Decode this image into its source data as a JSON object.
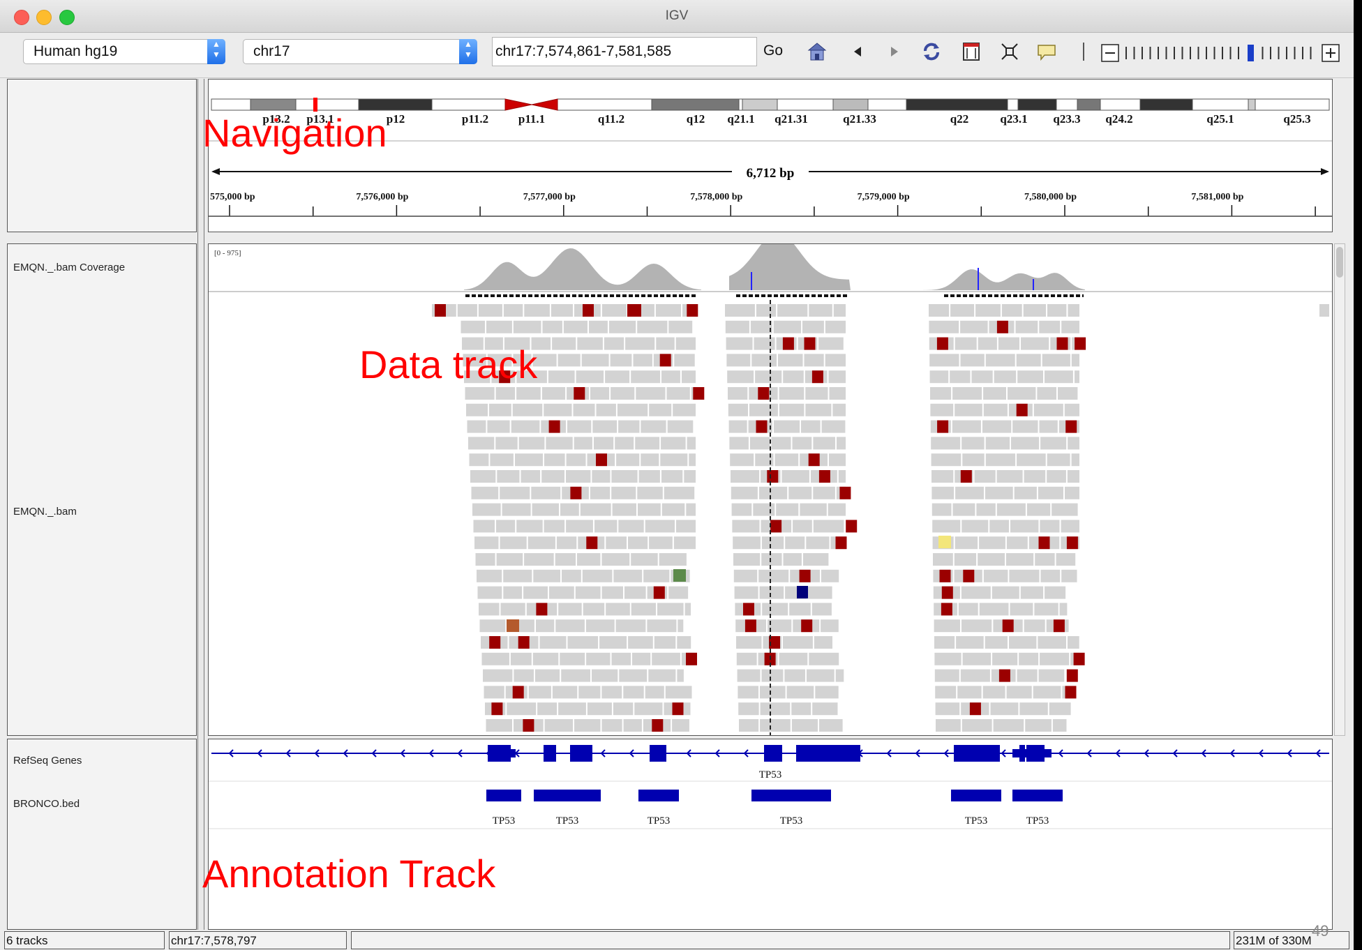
{
  "window": {
    "title": "IGV"
  },
  "toolbar": {
    "genome": "Human hg19",
    "chromosome": "chr17",
    "locus": "chr17:7,574,861-7,581,585",
    "go_label": "Go"
  },
  "ideogram": {
    "bands": [
      "p13.2",
      "p13.1",
      "p12",
      "p11.2",
      "p11.1",
      "q11.2",
      "q12",
      "q21.1",
      "q21.31",
      "q21.33",
      "q22",
      "q23.1",
      "q23.3",
      "q24.2",
      "q25.1",
      "q25.3"
    ]
  },
  "ruler": {
    "span": "6,712 bp",
    "ticks": [
      "575,000 bp",
      "7,576,000 bp",
      "7,577,000 bp",
      "7,578,000 bp",
      "7,579,000 bp",
      "7,580,000 bp",
      "7,581,000 bp"
    ]
  },
  "tracks": {
    "coverage_name": "EMQN._.bam Coverage",
    "coverage_range": "[0 - 975]",
    "bam_name": "EMQN._.bam",
    "refseq_name": "RefSeq Genes",
    "refseq_gene": "TP53",
    "bed_name": "BRONCO.bed",
    "bed_features": [
      "TP53",
      "TP53",
      "TP53",
      "TP53",
      "TP53",
      "TP53"
    ]
  },
  "overlays": {
    "navigation": "Navigation",
    "data_track": "Data track",
    "annotation_track": "Annotation Track"
  },
  "status": {
    "tracks": "6 tracks",
    "position": "chr17:7,578,797",
    "memory": "231M of 330M",
    "slide_number": "49"
  },
  "colors": {
    "mismatch": "#9b0000",
    "read": "#d3d3d3",
    "coverage": "#b3b3b3",
    "gene": "#0000b0",
    "overlay_text": "#ff0000"
  }
}
